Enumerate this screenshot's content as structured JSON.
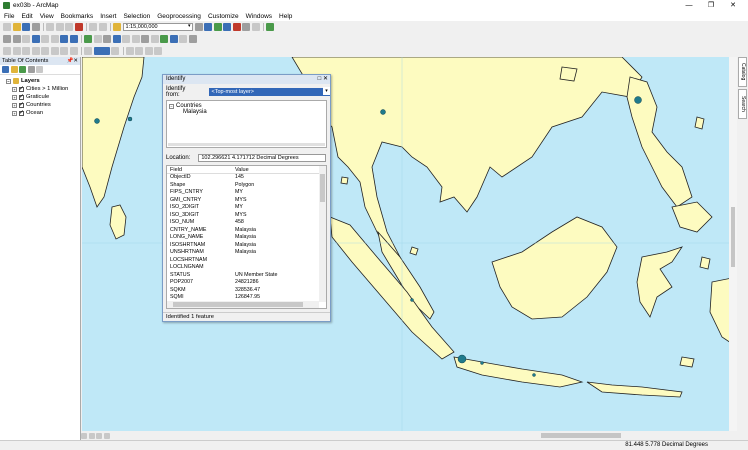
{
  "window": {
    "title": "ex03b - ArcMap",
    "controls": [
      "—",
      "❐",
      "✕"
    ]
  },
  "menu": [
    "File",
    "Edit",
    "View",
    "Bookmarks",
    "Insert",
    "Selection",
    "Geoprocessing",
    "Customize",
    "Windows",
    "Help"
  ],
  "toolbar": {
    "scale": "1:15,000,000"
  },
  "toc": {
    "title": "Table Of Contents",
    "root": "Layers",
    "layers": [
      "Cities > 1 Million",
      "Graticule",
      "Countries",
      "Ocean"
    ]
  },
  "side_tabs": [
    "Catalog",
    "Search"
  ],
  "identify": {
    "title": "Identify",
    "from_label": "Identify from:",
    "from_value": "<Top-most layer>",
    "tree_layer": "Countries",
    "tree_feature": "Malaysia",
    "location_label": "Location:",
    "location_value": "102.296621  4.171712 Decimal Degrees",
    "field_header": "Field",
    "value_header": "Value",
    "rows": [
      {
        "f": "ObjectID",
        "v": "145"
      },
      {
        "f": "Shape",
        "v": "Polygon"
      },
      {
        "f": "FIPS_CNTRY",
        "v": "MY"
      },
      {
        "f": "GMI_CNTRY",
        "v": "MYS"
      },
      {
        "f": "ISO_2DIGIT",
        "v": "MY"
      },
      {
        "f": "ISO_3DIGIT",
        "v": "MYS"
      },
      {
        "f": "ISO_NUM",
        "v": "458"
      },
      {
        "f": "CNTRY_NAME",
        "v": "Malaysia"
      },
      {
        "f": "LONG_NAME",
        "v": "Malaysia"
      },
      {
        "f": "ISOSHRTNAM",
        "v": "Malaysia"
      },
      {
        "f": "UNSHRTNAM",
        "v": "Malaysia"
      },
      {
        "f": "LOCSHRTNAM",
        "v": ""
      },
      {
        "f": "LOCLNGNAM",
        "v": ""
      },
      {
        "f": "STATUS",
        "v": "UN Member State"
      },
      {
        "f": "POP2007",
        "v": "24821286"
      },
      {
        "f": "SQKM",
        "v": "328536.47"
      },
      {
        "f": "SQMI",
        "v": "126847.95"
      }
    ],
    "status": "Identified 1 feature"
  },
  "statusbar": {
    "coords": "81.448  5.778 Decimal Degrees"
  },
  "colors": {
    "ocean": "#bfe8f7",
    "land": "#fdfbc0",
    "city": "#1f7a8c"
  }
}
